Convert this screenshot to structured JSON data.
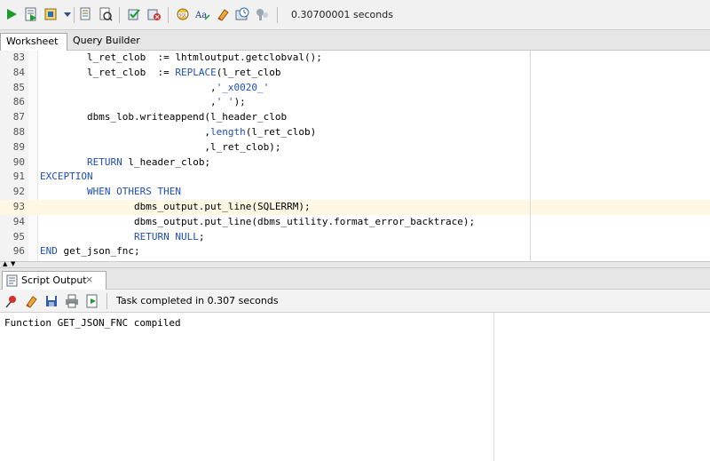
{
  "toolbar": {
    "icons": [
      "run-statement-icon",
      "run-script-icon",
      "commit-icon",
      "dropdown-icon",
      "explain-plan-icon",
      "autotrace-icon",
      "commit-transaction-icon",
      "rollback-icon",
      "sql-tuning-icon",
      "format-icon",
      "clear-icon",
      "history-icon",
      "unshared-sql-icon"
    ],
    "elapsed": "0.30700001 seconds"
  },
  "tabs": [
    {
      "label": "Worksheet",
      "active": true
    },
    {
      "label": "Query Builder",
      "active": false
    }
  ],
  "editor": {
    "lines": [
      {
        "n": "83",
        "text": "        l_ret_clob  := lhtmloutput.getclobval();"
      },
      {
        "n": "84",
        "text": "        l_ret_clob  := REPLACE(l_ret_clob"
      },
      {
        "n": "85",
        "text": "                             ,'_x0020_'"
      },
      {
        "n": "86",
        "text": "                             ,' ');"
      },
      {
        "n": "87",
        "text": "        dbms_lob.writeappend(l_header_clob"
      },
      {
        "n": "88",
        "text": "                            ,length(l_ret_clob)"
      },
      {
        "n": "89",
        "text": "                            ,l_ret_clob);"
      },
      {
        "n": "90",
        "text": "        RETURN l_header_clob;"
      },
      {
        "n": "91",
        "text": "EXCEPTION"
      },
      {
        "n": "92",
        "text": "        WHEN OTHERS THEN"
      },
      {
        "n": "93",
        "text": "                dbms_output.put_line(SQLERRM);"
      },
      {
        "n": "94",
        "text": "                dbms_output.put_line(dbms_utility.format_error_backtrace);"
      },
      {
        "n": "95",
        "text": "                RETURN NULL;"
      },
      {
        "n": "96",
        "text": "END get_json_fnc;"
      }
    ],
    "highlighted_line": "93"
  },
  "output_panel": {
    "tab_label": "Script Output",
    "close_label": "×",
    "task_status": "Task completed in 0.307 seconds",
    "output_text": "Function GET_JSON_FNC compiled"
  }
}
